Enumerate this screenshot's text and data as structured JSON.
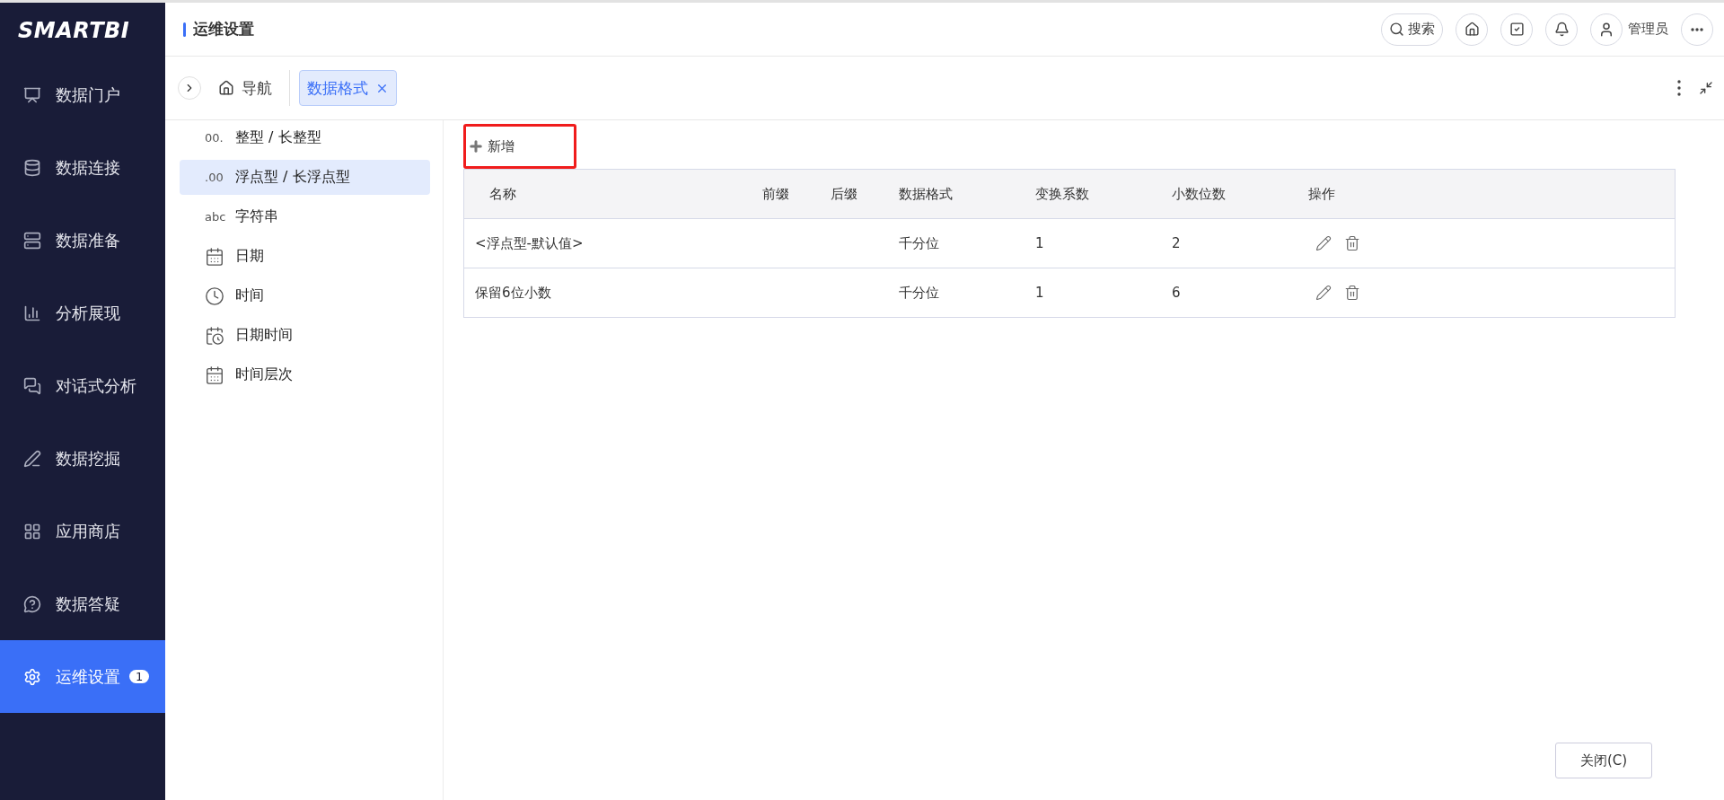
{
  "logo": "SMARTBI",
  "sidebar": {
    "items": [
      {
        "label": "数据门户",
        "selected": false
      },
      {
        "label": "数据连接",
        "selected": false
      },
      {
        "label": "数据准备",
        "selected": false
      },
      {
        "label": "分析展现",
        "selected": false
      },
      {
        "label": "对话式分析",
        "selected": false
      },
      {
        "label": "数据挖掘",
        "selected": false
      },
      {
        "label": "应用商店",
        "selected": false
      },
      {
        "label": "数据答疑",
        "selected": false
      },
      {
        "label": "运维设置",
        "selected": true,
        "badge": "1"
      }
    ]
  },
  "header": {
    "title": "运维设置",
    "search": "搜索",
    "user": "管理员"
  },
  "tabs": [
    {
      "label": "导航",
      "selected": false,
      "closable": false
    },
    {
      "label": "数据格式",
      "selected": true,
      "closable": true
    }
  ],
  "format_types": [
    {
      "kind": "glyph",
      "glyph": "00.",
      "label": "整型 / 长整型",
      "selected": false
    },
    {
      "kind": "glyph",
      "glyph": ".00",
      "label": "浮点型 / 长浮点型",
      "selected": true
    },
    {
      "kind": "glyph",
      "glyph": "abc",
      "label": "字符串",
      "selected": false
    },
    {
      "kind": "calendar",
      "label": "日期",
      "selected": false
    },
    {
      "kind": "clock",
      "label": "时间",
      "selected": false
    },
    {
      "kind": "calendar-clock",
      "label": "日期时间",
      "selected": false
    },
    {
      "kind": "calendar",
      "label": "时间层次",
      "selected": false
    }
  ],
  "add_button": {
    "label": "新增",
    "highlighted": true
  },
  "table": {
    "columns": [
      "名称",
      "前缀",
      "后缀",
      "数据格式",
      "变换系数",
      "小数位数",
      "操作"
    ],
    "rows": [
      [
        "<浮点型-默认值>",
        "",
        "",
        "千分位",
        "1",
        "2"
      ],
      [
        "保留6位小数",
        "",
        "",
        "千分位",
        "1",
        "6"
      ]
    ]
  },
  "close_button": "关闭(C)"
}
